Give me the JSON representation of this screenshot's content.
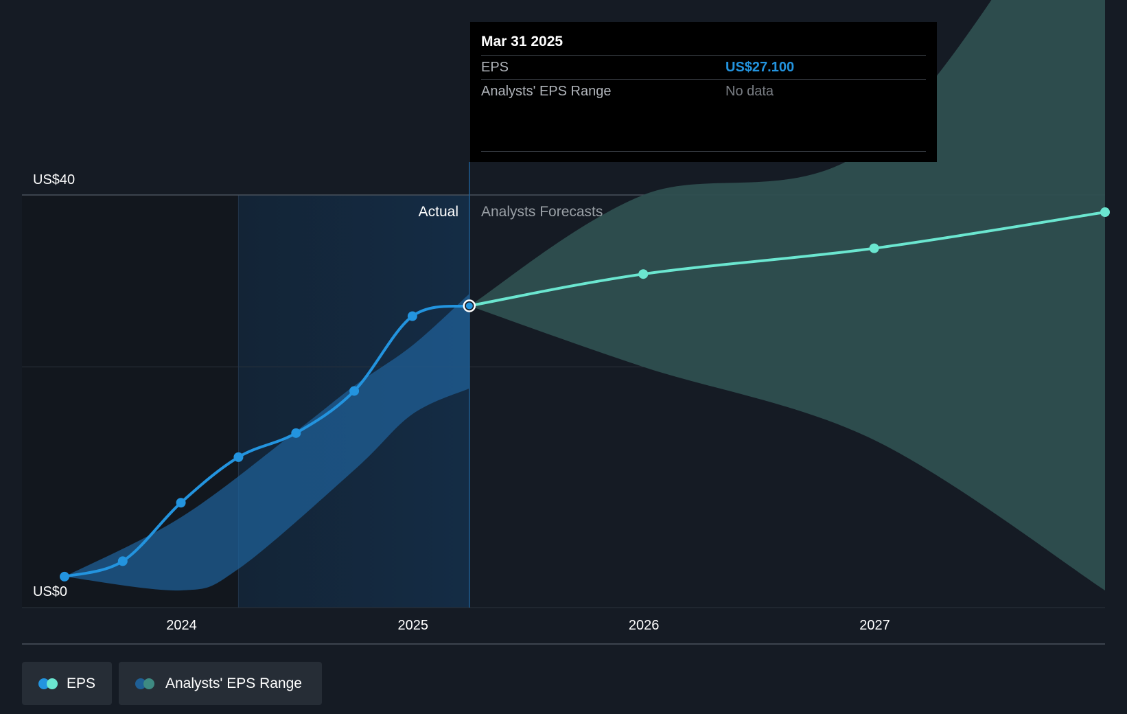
{
  "tooltip": {
    "date": "Mar 31 2025",
    "rows": [
      {
        "label": "EPS",
        "value": "US$27.100"
      },
      {
        "label": "Analysts' EPS Range",
        "value": "No data"
      }
    ]
  },
  "regions": {
    "actual_label": "Actual",
    "forecast_label": "Analysts Forecasts"
  },
  "legend": {
    "eps_label": "EPS",
    "range_label": "Analysts' EPS Range"
  },
  "colors": {
    "background": "#151b24",
    "eps_actual": "#2394df",
    "eps_forecast": "#6be6d0",
    "range_forecast": "#2e4f50",
    "range_actual": "#1f5f95"
  },
  "chart_data": {
    "type": "line",
    "y_tick_labels": [
      {
        "value": 0,
        "label": "US$0"
      },
      {
        "value": 40,
        "label": "US$40"
      }
    ],
    "ylim": [
      -8,
      40
    ],
    "x_tick_labels": [
      "2024",
      "2025",
      "2026",
      "2027"
    ],
    "xlim": [
      "2023-06-30",
      "2027-12-31"
    ],
    "grid": true,
    "divider_date": "2025-03-31",
    "series": [
      {
        "name": "EPS",
        "segment": "actual",
        "points": [
          {
            "x": "2023-06-30",
            "y": -4.4
          },
          {
            "x": "2023-09-30",
            "y": -2.6
          },
          {
            "x": "2023-12-31",
            "y": 4.2
          },
          {
            "x": "2024-03-31",
            "y": 9.5
          },
          {
            "x": "2024-06-30",
            "y": 12.3
          },
          {
            "x": "2024-09-30",
            "y": 17.2
          },
          {
            "x": "2024-12-31",
            "y": 25.9
          },
          {
            "x": "2025-03-31",
            "y": 27.1
          }
        ]
      },
      {
        "name": "EPS",
        "segment": "forecast",
        "points": [
          {
            "x": "2025-03-31",
            "y": 27.1
          },
          {
            "x": "2025-12-31",
            "y": 30.8
          },
          {
            "x": "2026-12-31",
            "y": 33.8
          },
          {
            "x": "2027-12-31",
            "y": 38.0
          }
        ]
      },
      {
        "name": "Analysts' EPS Range",
        "segment": "actual",
        "upper": [
          {
            "x": "2023-06-30",
            "y": -4.4
          },
          {
            "x": "2023-12-31",
            "y": 2.5
          },
          {
            "x": "2024-06-30",
            "y": 12.5
          },
          {
            "x": "2024-09-30",
            "y": 17.8
          },
          {
            "x": "2024-12-31",
            "y": 22.5
          },
          {
            "x": "2025-03-31",
            "y": 28.5
          }
        ],
        "lower": [
          {
            "x": "2023-06-30",
            "y": -4.4
          },
          {
            "x": "2023-12-31",
            "y": -6.0
          },
          {
            "x": "2024-03-31",
            "y": -3.5
          },
          {
            "x": "2024-09-30",
            "y": 8.0
          },
          {
            "x": "2024-12-31",
            "y": 14.5
          },
          {
            "x": "2025-03-31",
            "y": 17.5
          }
        ]
      },
      {
        "name": "Analysts' EPS Range",
        "segment": "forecast",
        "upper": [
          {
            "x": "2025-03-31",
            "y": 27.1
          },
          {
            "x": "2025-12-31",
            "y": 40.0
          },
          {
            "x": "2026-12-31",
            "y": 46.0
          },
          {
            "x": "2027-12-31",
            "y": 83.0
          }
        ],
        "lower": [
          {
            "x": "2025-03-31",
            "y": 27.1
          },
          {
            "x": "2025-12-31",
            "y": 20.0
          },
          {
            "x": "2026-12-31",
            "y": 11.5
          },
          {
            "x": "2027-12-31",
            "y": -6.0
          }
        ]
      }
    ]
  }
}
